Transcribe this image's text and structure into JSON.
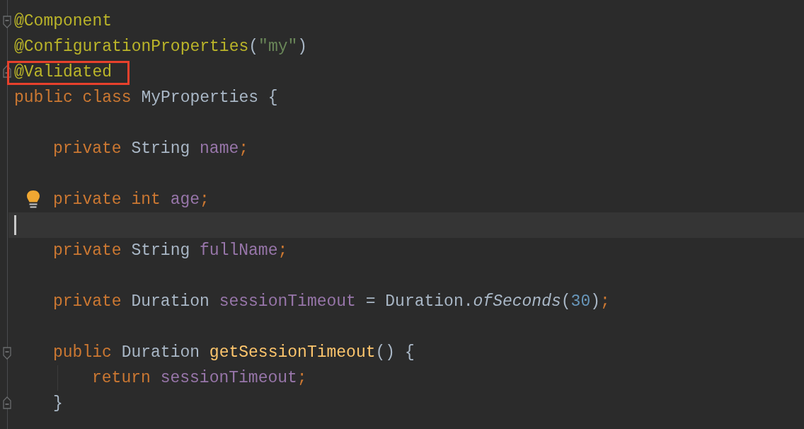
{
  "editor": {
    "lines": [
      {
        "fold_start": true,
        "fold_end": false,
        "bulb": false,
        "current": false,
        "boxed": false,
        "tokens": [
          {
            "text": "@Component",
            "kind": "annotation"
          }
        ]
      },
      {
        "fold_start": false,
        "fold_end": false,
        "bulb": false,
        "current": false,
        "boxed": false,
        "tokens": [
          {
            "text": "@ConfigurationProperties",
            "kind": "annotation"
          },
          {
            "text": "(",
            "kind": "plain"
          },
          {
            "text": "\"my\"",
            "kind": "string"
          },
          {
            "text": ")",
            "kind": "plain"
          }
        ]
      },
      {
        "fold_start": false,
        "fold_end": true,
        "bulb": false,
        "current": false,
        "boxed": true,
        "tokens": [
          {
            "text": "@Validated",
            "kind": "annotation"
          }
        ]
      },
      {
        "fold_start": false,
        "fold_end": false,
        "bulb": false,
        "current": false,
        "boxed": false,
        "tokens": [
          {
            "text": "public class ",
            "kind": "keyword"
          },
          {
            "text": "MyProperties {",
            "kind": "plain"
          }
        ],
        "children": [
          {
            "fold_start": false,
            "fold_end": false,
            "bulb": false,
            "current": false,
            "boxed": false
          },
          {
            "fold_start": false,
            "fold_end": false,
            "bulb": false,
            "current": false,
            "boxed": false,
            "tokens": [
              {
                "text": "private ",
                "kind": "keyword"
              },
              {
                "text": "String ",
                "kind": "plain"
              },
              {
                "text": "name",
                "kind": "field"
              },
              {
                "text": ";",
                "kind": "keyword"
              }
            ]
          },
          {
            "fold_start": false,
            "fold_end": false,
            "bulb": false,
            "current": false,
            "boxed": false
          },
          {
            "fold_start": false,
            "fold_end": false,
            "bulb": true,
            "current": false,
            "boxed": false,
            "tokens": [
              {
                "text": "private int ",
                "kind": "keyword"
              },
              {
                "text": "age",
                "kind": "field"
              },
              {
                "text": ";",
                "kind": "keyword"
              }
            ]
          },
          {
            "fold_start": false,
            "fold_end": false,
            "bulb": false,
            "current": true,
            "boxed": false
          },
          {
            "fold_start": false,
            "fold_end": false,
            "bulb": false,
            "current": false,
            "boxed": false,
            "tokens": [
              {
                "text": "private ",
                "kind": "keyword"
              },
              {
                "text": "String ",
                "kind": "plain"
              },
              {
                "text": "fullName",
                "kind": "field"
              },
              {
                "text": ";",
                "kind": "keyword"
              }
            ]
          },
          {
            "fold_start": false,
            "fold_end": false,
            "bulb": false,
            "current": false,
            "boxed": false
          },
          {
            "fold_start": false,
            "fold_end": false,
            "bulb": false,
            "current": false,
            "boxed": false,
            "tokens": [
              {
                "text": "private ",
                "kind": "keyword"
              },
              {
                "text": "Duration ",
                "kind": "plain"
              },
              {
                "text": "sessionTimeout",
                "kind": "field"
              },
              {
                "text": " = Duration.",
                "kind": "plain"
              },
              {
                "text": "ofSeconds",
                "kind": "static"
              },
              {
                "text": "(",
                "kind": "plain"
              },
              {
                "text": "30",
                "kind": "number"
              },
              {
                "text": ")",
                "kind": "plain"
              },
              {
                "text": ";",
                "kind": "keyword"
              }
            ]
          },
          {
            "fold_start": false,
            "fold_end": false,
            "bulb": false,
            "current": false,
            "boxed": false
          },
          {
            "fold_start": true,
            "fold_end": false,
            "bulb": false,
            "current": false,
            "boxed": false,
            "tokens": [
              {
                "text": "public ",
                "kind": "keyword"
              },
              {
                "text": "Duration ",
                "kind": "plain"
              },
              {
                "text": "getSessionTimeout",
                "kind": "method"
              },
              {
                "text": "() {",
                "kind": "plain"
              }
            ],
            "children": [
              {
                "fold_start": false,
                "fold_end": false,
                "bulb": false,
                "current": false,
                "boxed": false,
                "tokens": [
                  {
                    "text": "return ",
                    "kind": "keyword"
                  },
                  {
                    "text": "sessionTimeout",
                    "kind": "field"
                  },
                  {
                    "text": ";",
                    "kind": "keyword"
                  }
                ]
              }
            ]
          },
          {
            "fold_start": false,
            "fold_end": true,
            "bulb": false,
            "current": false,
            "boxed": false,
            "tokens": [
              {
                "text": "}",
                "kind": "plain"
              }
            ]
          },
          {
            "fold_start": false,
            "fold_end": false,
            "bulb": false,
            "current": false,
            "boxed": false
          }
        ]
      }
    ]
  }
}
